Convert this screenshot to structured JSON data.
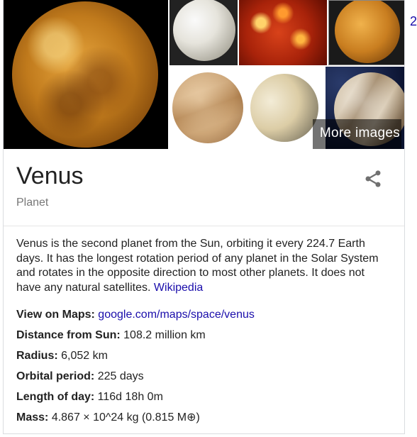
{
  "gallery": {
    "more_images_label": "More images"
  },
  "entity": {
    "title": "Venus",
    "subtitle": "Planet",
    "share_icon": "share-icon"
  },
  "description": {
    "text": "Venus is the second planet from the Sun, orbiting it every 224.7 Earth days. It has the longest rotation period of any planet in the Solar System and rotates in the opposite direction to most other planets. It does not have any natural satellites.",
    "source_link": "Wikipedia"
  },
  "facts": [
    {
      "label": "View on Maps:",
      "value": "google.com/maps/space/venus",
      "is_link": true
    },
    {
      "label": "Distance from Sun:",
      "value": "108.2 million km"
    },
    {
      "label": "Radius:",
      "value": "6,052 km"
    },
    {
      "label": "Orbital period:",
      "value": "225 days"
    },
    {
      "label": "Length of day:",
      "value": "116d 18h 0m"
    },
    {
      "label": "Mass:",
      "value": "4.867 × 10^24 kg (0.815 M⊕)"
    }
  ],
  "edge_text": "2",
  "colors": {
    "link": "#1a0dab",
    "muted": "#777777",
    "text": "#222222"
  }
}
